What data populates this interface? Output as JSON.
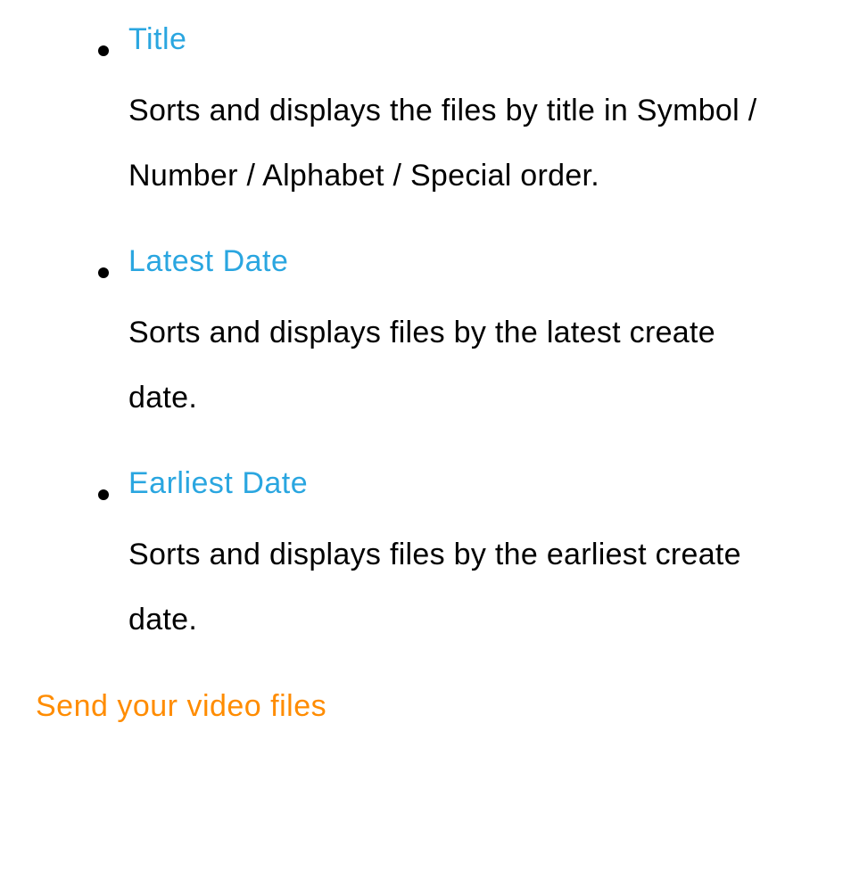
{
  "sort_options": [
    {
      "title": "Title",
      "description": "Sorts and displays the files by title in Symbol / Number / Alphabet / Special order."
    },
    {
      "title": "Latest Date",
      "description": "Sorts and displays files by the latest create date."
    },
    {
      "title": "Earliest Date",
      "description": "Sorts and displays files by the earliest create date."
    }
  ],
  "section_heading": "Send your video files"
}
